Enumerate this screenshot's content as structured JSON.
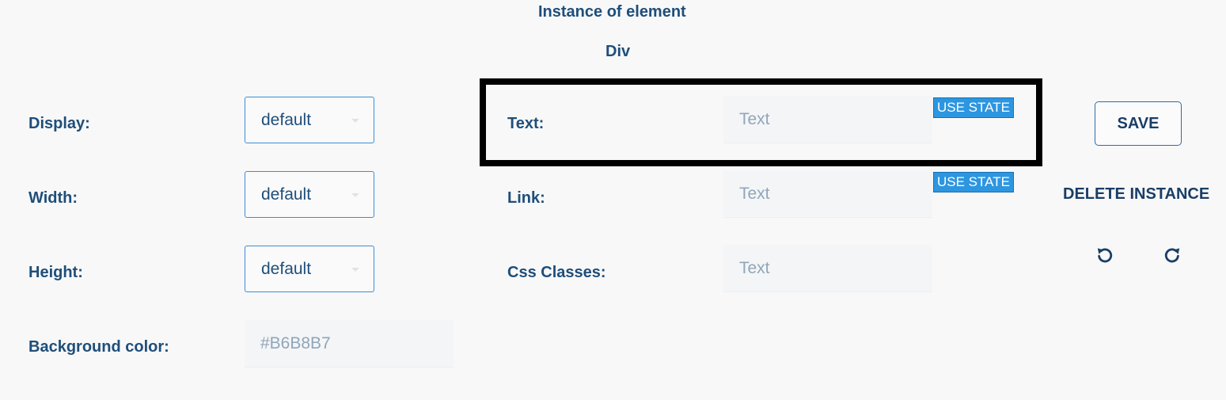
{
  "header": {
    "title": "Instance of element",
    "element_type": "Div"
  },
  "left": {
    "display": {
      "label": "Display:",
      "value": "default"
    },
    "width": {
      "label": "Width:",
      "value": "default"
    },
    "height": {
      "label": "Height:",
      "value": "default"
    },
    "background": {
      "label": "Background color:",
      "placeholder": "#B6B8B7"
    }
  },
  "middle": {
    "text": {
      "label": "Text:",
      "placeholder": "Text",
      "use_state": "USE STATE"
    },
    "link": {
      "label": "Link:",
      "placeholder": "Text",
      "use_state": "USE STATE"
    },
    "css": {
      "label": "Css Classes:",
      "placeholder": "Text"
    }
  },
  "actions": {
    "save": "SAVE",
    "delete": "DELETE INSTANCE",
    "undo_icon": "undo-icon",
    "redo_icon": "redo-icon"
  },
  "colors": {
    "primary_text": "#1f4e79",
    "use_state_bg": "#2d96e0",
    "focus_border": "#000000"
  }
}
